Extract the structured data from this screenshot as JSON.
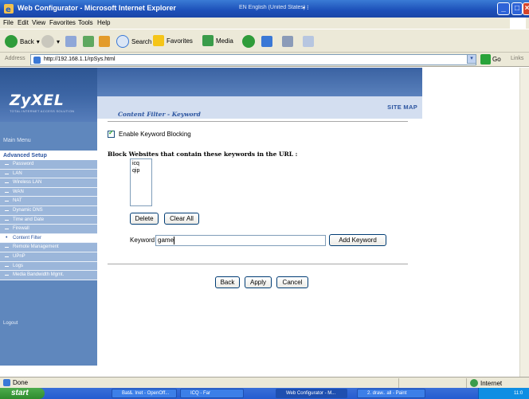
{
  "window": {
    "title": "Web Configurator - Microsoft Internet Explorer",
    "language": "EN English (United States)"
  },
  "menu": [
    "File",
    "Edit",
    "View",
    "Favorites",
    "Tools",
    "Help"
  ],
  "toolbar": {
    "back": "Back",
    "search": "Search",
    "favorites": "Favorites",
    "media": "Media"
  },
  "address": {
    "label": "Address",
    "url": "http://192.168.1.1/rpSys.html",
    "go": "Go",
    "links": "Links"
  },
  "nav": {
    "logo": "ZyXEL",
    "logo_tagline": "TOTAL INTERNET ACCESS SOLUTION",
    "main_menu": "Main Menu",
    "advanced_setup": "Advanced Setup",
    "items": [
      "Password",
      "LAN",
      "Wireless LAN",
      "WAN",
      "NAT",
      "Dynamic DNS",
      "Time and Date",
      "Firewall",
      "Content Filter",
      "Remote Management",
      "UPnP",
      "Logs",
      "Media Bandwidth Mgmt."
    ],
    "active_index": 8,
    "logout": "Logout"
  },
  "header": {
    "site_map": "SITE MAP",
    "page_title": "Content Filter - Keyword"
  },
  "form": {
    "enable_label": "Enable Keyword Blocking",
    "enable_checked": true,
    "block_header": "Block Websites that contain these keywords in the URL :",
    "keywords": [
      "icq",
      "qip"
    ],
    "delete": "Delete",
    "clear_all": "Clear All",
    "keyword_label": "Keyword",
    "keyword_value": "game",
    "add_keyword": "Add Keyword",
    "back": "Back",
    "apply": "Apply",
    "cancel": "Cancel"
  },
  "status": {
    "done": "Done",
    "zone": "Internet"
  },
  "taskbar": {
    "start": "start",
    "items": [
      "Bat&. Inet - OpenOff...",
      "ICQ - Far",
      "Web Configurator - M...",
      "2. draw.. all - Paint"
    ],
    "clock": "11:0"
  },
  "colors": {
    "accent": "#2c55a0",
    "nav_bg": "#5f87bd",
    "subnav_bg": "#9bb6da",
    "sitemap_bg": "#d3def0"
  }
}
